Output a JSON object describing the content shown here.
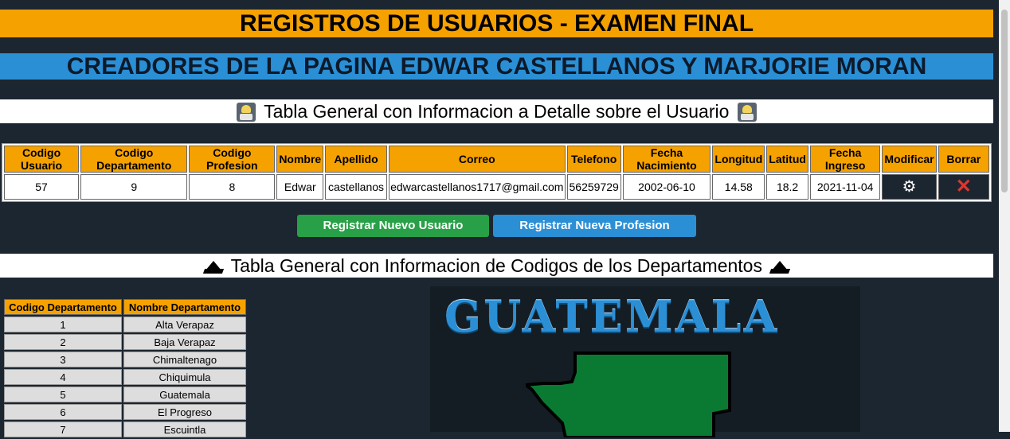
{
  "banner": {
    "title": "REGISTROS DE USUARIOS - EXAMEN FINAL",
    "creators": "CREADORES DE LA PAGINA EDWAR CASTELLANOS Y MARJORIE MORAN"
  },
  "users_section": {
    "title": "Tabla General con Informacion a Detalle sobre el Usuario",
    "headers": [
      "Codigo Usuario",
      "Codigo Departamento",
      "Codigo Profesion",
      "Nombre",
      "Apellido",
      "Correo",
      "Telefono",
      "Fecha Nacimiento",
      "Longitud",
      "Latitud",
      "Fecha Ingreso",
      "Modificar",
      "Borrar"
    ],
    "rows": [
      {
        "codigo_usuario": "57",
        "codigo_departamento": "9",
        "codigo_profesion": "8",
        "nombre": "Edwar",
        "apellido": "castellanos",
        "correo": "edwarcastellanos1717@gmail.com",
        "telefono": "56259729",
        "fecha_nacimiento": "2002-06-10",
        "longitud": "14.58",
        "latitud": "18.2",
        "fecha_ingreso": "2021-11-04",
        "modificar_icon": "gear-icon",
        "borrar_icon": "close-icon"
      }
    ]
  },
  "actions": {
    "register_user": "Registrar Nuevo Usuario",
    "register_profession": "Registrar Nueva Profesion"
  },
  "dept_section": {
    "title": "Tabla General con Informacion de Codigos de los Departamentos",
    "headers": [
      "Codigo Departamento",
      "Nombre Departamento"
    ],
    "rows": [
      {
        "code": "1",
        "name": "Alta Verapaz"
      },
      {
        "code": "2",
        "name": "Baja Verapaz"
      },
      {
        "code": "3",
        "name": "Chimaltenago"
      },
      {
        "code": "4",
        "name": "Chiquimula"
      },
      {
        "code": "5",
        "name": "Guatemala"
      },
      {
        "code": "6",
        "name": "El Progreso"
      },
      {
        "code": "7",
        "name": "Escuintla"
      }
    ]
  },
  "map": {
    "title": "GUATEMALA"
  },
  "colors": {
    "orange": "#f5a100",
    "blue": "#2b8fd6",
    "green": "#28a047",
    "background": "#1c2630"
  }
}
